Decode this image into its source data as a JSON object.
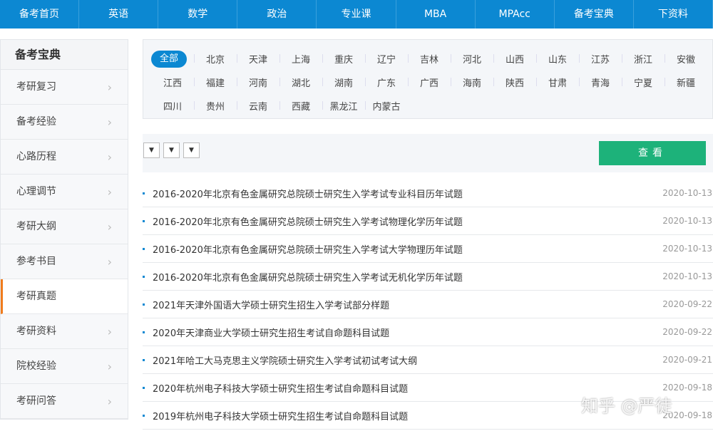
{
  "nav": [
    "备考首页",
    "英语",
    "数学",
    "政治",
    "专业课",
    "MBA",
    "MPAcc",
    "备考宝典",
    "下资料"
  ],
  "sidebar": {
    "title": "备考宝典",
    "items": [
      "考研复习",
      "备考经验",
      "心路历程",
      "心理调节",
      "考研大纲",
      "参考书目",
      "考研真题",
      "考研资料",
      "院校经验",
      "考研问答"
    ],
    "active": "考研真题"
  },
  "provinces": [
    [
      "全部",
      "北京",
      "天津",
      "上海",
      "重庆",
      "辽宁",
      "吉林",
      "河北",
      "山西",
      "山东",
      "江苏",
      "浙江",
      "安徽"
    ],
    [
      "江西",
      "福建",
      "河南",
      "湖北",
      "湖南",
      "广东",
      "广西",
      "海南",
      "陕西",
      "甘肃",
      "青海",
      "宁夏",
      "新疆"
    ],
    [
      "四川",
      "贵州",
      "云南",
      "西藏",
      "黑龙江",
      "内蒙古"
    ]
  ],
  "filter": {
    "select_glyph": "▼",
    "view_button": "查看"
  },
  "articles": [
    {
      "title": "2016-2020年北京有色金属研究总院硕士研究生入学考试专业科目历年试题",
      "date": "2020-10-13"
    },
    {
      "title": "2016-2020年北京有色金属研究总院硕士研究生入学考试物理化学历年试题",
      "date": "2020-10-13"
    },
    {
      "title": "2016-2020年北京有色金属研究总院硕士研究生入学考试大学物理历年试题",
      "date": "2020-10-13"
    },
    {
      "title": "2016-2020年北京有色金属研究总院硕士研究生入学考试无机化学历年试题",
      "date": "2020-10-13"
    },
    {
      "title": "2021年天津外国语大学硕士研究生招生入学考试部分样题",
      "date": "2020-09-22"
    },
    {
      "title": "2020年天津商业大学硕士研究生招生考试自命题科目试题",
      "date": "2020-09-22"
    },
    {
      "title": "2021年哈工大马克思主义学院硕士研究生入学考试初试考试大纲",
      "date": "2020-09-21"
    },
    {
      "title": "2020年杭州电子科技大学硕士研究生招生考试自命题科目试题",
      "date": "2020-09-18"
    },
    {
      "title": "2019年杭州电子科技大学硕士研究生招生考试自命题科目试题",
      "date": "2020-09-18"
    }
  ],
  "watermark": "知乎 @严徒"
}
